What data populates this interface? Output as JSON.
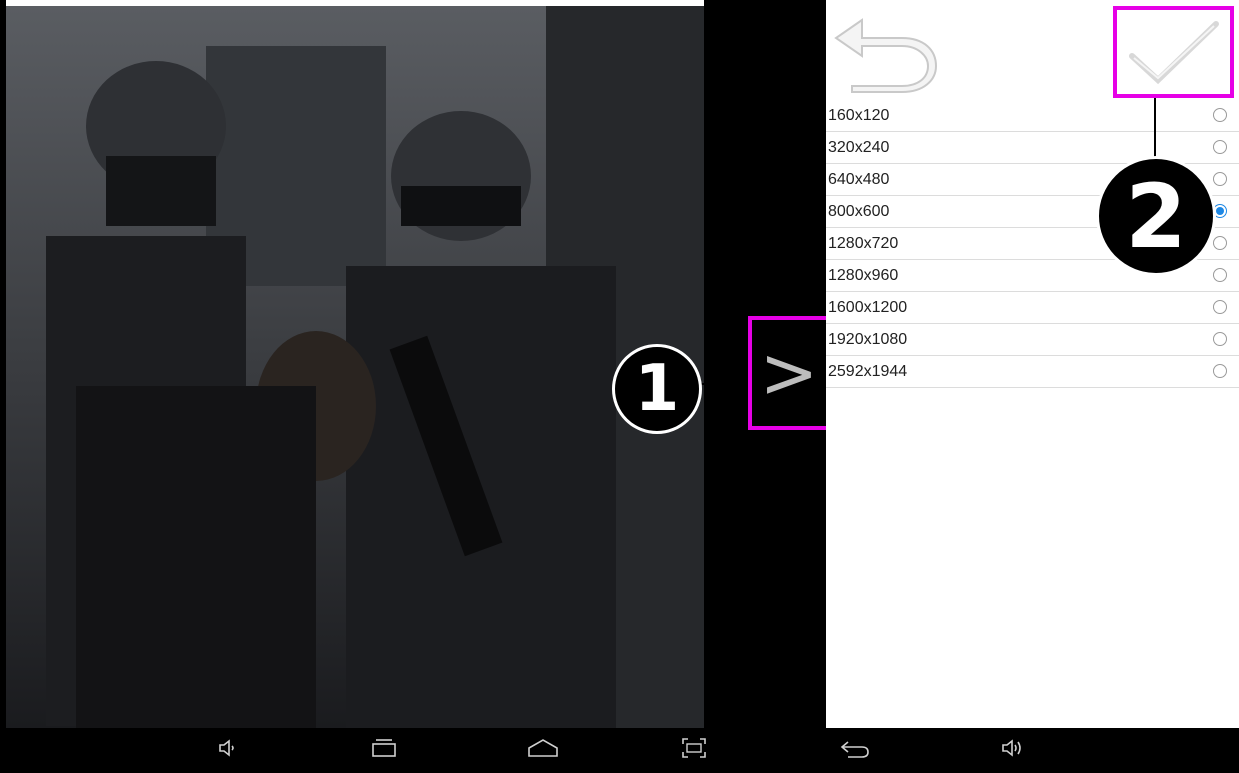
{
  "preview": {},
  "toggle": {
    "icon": "chevron-right-icon",
    "label": ">"
  },
  "callouts": {
    "one": "1",
    "two": "2"
  },
  "header": {
    "back_icon": "back-arrow-icon",
    "confirm_icon": "check-icon"
  },
  "resolutions": [
    {
      "label": "160x120",
      "selected": false
    },
    {
      "label": "320x240",
      "selected": false
    },
    {
      "label": "640x480",
      "selected": false
    },
    {
      "label": "800x600",
      "selected": true
    },
    {
      "label": "1280x720",
      "selected": false
    },
    {
      "label": "1280x960",
      "selected": false
    },
    {
      "label": "1600x1200",
      "selected": false
    },
    {
      "label": "1920x1080",
      "selected": false
    },
    {
      "label": "2592x1944",
      "selected": false
    }
  ],
  "navbar": {
    "icons": [
      "volume-down-icon",
      "recent-apps-icon",
      "home-icon",
      "screenshot-icon",
      "back-icon",
      "volume-up-icon"
    ]
  },
  "colors": {
    "highlight": "#e600e6",
    "radio_selected": "#1e88e5"
  }
}
